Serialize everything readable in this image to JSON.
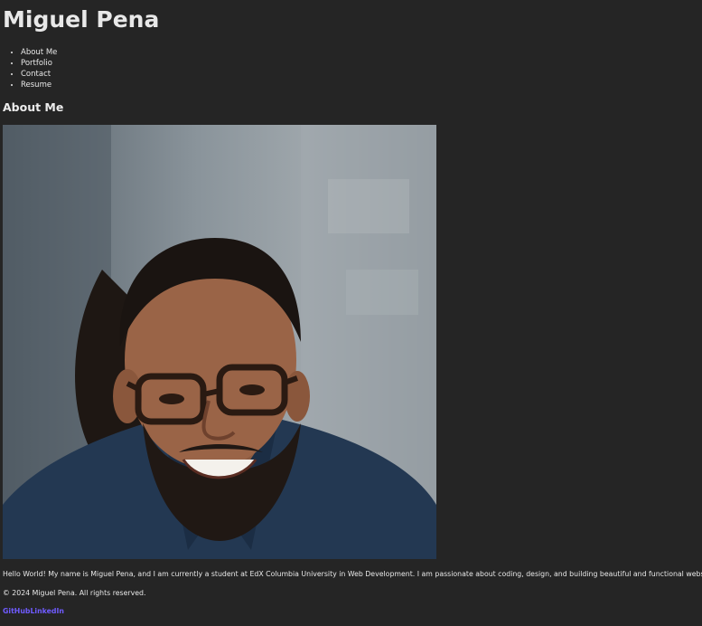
{
  "header": {
    "title": "Miguel Pena"
  },
  "nav": {
    "items": [
      {
        "label": "About Me"
      },
      {
        "label": "Portfolio"
      },
      {
        "label": "Contact"
      },
      {
        "label": "Resume"
      }
    ]
  },
  "about": {
    "heading": "About Me",
    "intro": "Hello World! My name is Miguel Pena, and I am currently a student at EdX Columbia University in Web Development. I am passionate about coding, design, and building beautiful and functional websites."
  },
  "footer": {
    "copyright": "© 2024 Miguel Pena. All rights reserved.",
    "links": [
      {
        "label": "GitHub"
      },
      {
        "label": "LinkedIn"
      }
    ]
  },
  "colors": {
    "background": "#252525",
    "text": "#ececec",
    "link": "#6f5bff"
  }
}
